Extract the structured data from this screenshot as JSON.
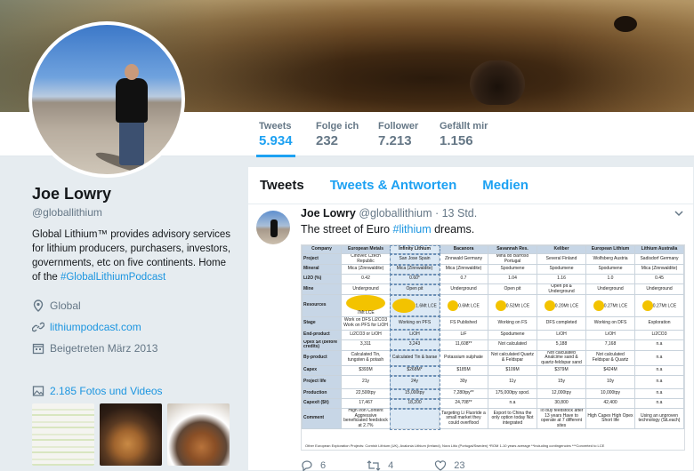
{
  "profile": {
    "name": "Joe Lowry",
    "handle": "@globallithium",
    "bio_text": "Global Lithium™ provides advisory services for lithium producers, purchasers, investors, governments, etc on five continents. Home of the ",
    "bio_tag": "#GlobalLithiumPodcast",
    "location": "Global",
    "website": "lithiumpodcast.com",
    "joined": "Beigetreten März 2013",
    "photos_link": "2.185 Fotos und Videos"
  },
  "stats": [
    {
      "label": "Tweets",
      "value": "5.934"
    },
    {
      "label": "Folge ich",
      "value": "232"
    },
    {
      "label": "Follower",
      "value": "7.213"
    },
    {
      "label": "Gefällt mir",
      "value": "1.156"
    }
  ],
  "tabs": [
    "Tweets",
    "Tweets & Antworten",
    "Medien"
  ],
  "tweet": {
    "name": "Joe Lowry",
    "handle": "@globallithium",
    "time": "· 13 Std.",
    "text_before": "The street of Euro ",
    "hashtag": "#lithium",
    "text_after": " dreams.",
    "replies": "6",
    "retweets": "4",
    "likes": "23"
  },
  "table": {
    "columns": [
      "Company",
      "European Metals",
      "Infinity Lithium",
      "Bacanora",
      "Savannah Res.",
      "Keliber",
      "European Lithium",
      "Lithium Australia"
    ],
    "rows": [
      {
        "label": "Project",
        "cells": [
          "Cinovec Czech Republic",
          "San Jose Spain",
          "Zinnwald Germany",
          "Mina do Barroso Portugal",
          "Several Finland",
          "Wolfsberg Austria",
          "Sadisdorf Germany"
        ]
      },
      {
        "label": "Mineral",
        "cells": [
          "Mica (Zinnwaldite)",
          "Mica (Zinnwaldite)",
          "Mica (Zinnwaldite)",
          "Spodumene",
          "Spodumene",
          "Spodumene",
          "Mica (Zinnwaldite)"
        ]
      },
      {
        "label": "Li2O (%)",
        "cells": [
          "0.42",
          "0.60*",
          "0.7",
          "1.04",
          "1.16",
          "1.0",
          "0.45"
        ]
      },
      {
        "label": "Mine",
        "cells": [
          "Underground",
          "Open pit",
          "Underground",
          "Open pit",
          "Open pit & Underground",
          "Underground",
          "Underground"
        ]
      },
      {
        "label": "Resources",
        "cells": [
          "7Mt LCE",
          "1.6Mt LCE",
          "0.6Mt LCE",
          "0.52Mt LCE",
          "0.20Mt LCE",
          "0.27Mt LCE",
          "0.27Mt LCE"
        ]
      },
      {
        "label": "Stage",
        "cells": [
          "Work on DFS Li2CO3 Work on PFS for LiOH",
          "Working on PFS",
          "FS Published",
          "Working on FS",
          "DFS completed",
          "Working on DFS",
          "Exploration"
        ]
      },
      {
        "label": "End-product",
        "cells": [
          "Li2CO3 or LiOH",
          "LiOH",
          "LiF",
          "Spodumene",
          "LiOH",
          "LiOH",
          "Li2CO3"
        ]
      },
      {
        "label": "Opex $/t (before credits)",
        "cells": [
          "3,311",
          "3,243",
          "11,608**",
          "Not calculated",
          "5,188",
          "7,168",
          "n.a"
        ]
      },
      {
        "label": "By-product",
        "cells": [
          "Calculated Tin, tungsten & potash",
          "Calculated Tin & barae",
          "Potassium sulphate",
          "Not calculated Quartz & Feldspar",
          "Not calculated Analcime sand & quartz-feldspar sand",
          "Not calculated Feldspar & Quartz",
          "n.a"
        ]
      },
      {
        "label": "Capex",
        "cells": [
          "$393M",
          "$268M*",
          "$185M",
          "$109M",
          "$379M",
          "$424M",
          "n.a"
        ]
      },
      {
        "label": "Project life",
        "cells": [
          "21y",
          "24y",
          "30y",
          "11y",
          "15y",
          "10y",
          "n.a"
        ]
      },
      {
        "label": "Production",
        "cells": [
          "22,500tpy",
          "15,000tpy",
          "7,280tpy**",
          "175,000tpy spod.",
          "12,000tpy",
          "10,000tpy",
          "n.a"
        ]
      },
      {
        "label": "Capex/t ($/t)",
        "cells": [
          "17,467",
          "18,200",
          "24,708**",
          "n.a",
          "30,800",
          "42,400",
          "n.a"
        ]
      },
      {
        "label": "Comment",
        "cells": [
          "High Iron Content Aggressive beneficiated feedstock at 2.7%",
          "",
          "Targeting Li Fluoride a small market they could overflood",
          "Export to China the only option today Not integrated",
          "To buy feedstock after 13 years Have to operate at 7 different sites",
          "High Capex High Opex Short life",
          "Using an unproven technology (SiLeach)"
        ]
      }
    ],
    "footnote": "Other European Exploration Projects: Cornish Lithium (UK), Avalonia Lithium (Ireland), Nora Litio (Portugal/Sweden) *ROM 1-10 years average **Including contingencies ***Converted to LCE"
  },
  "colors": {
    "accent": "#1da1f2",
    "link": "#1b95e0",
    "muted": "#657786",
    "highlight_column": "#dce9f5",
    "resource_circle": "#f3c300"
  }
}
